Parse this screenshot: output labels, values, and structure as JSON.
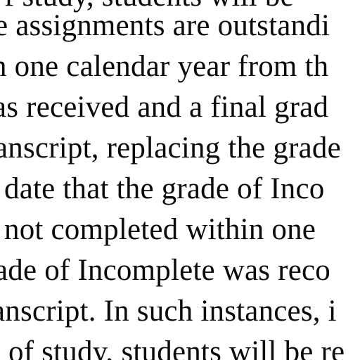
{
  "document": {
    "lines": [
      "f study, students will be",
      "e assignments are outstandi",
      "n one calendar year from th",
      "as received and a final grad",
      "anscript, replacing the grade",
      "date that the grade of Inco",
      " not completed within one",
      "ade of Incomplete was reco",
      "anscript. In such instances, i",
      "of study, students will be re"
    ]
  }
}
